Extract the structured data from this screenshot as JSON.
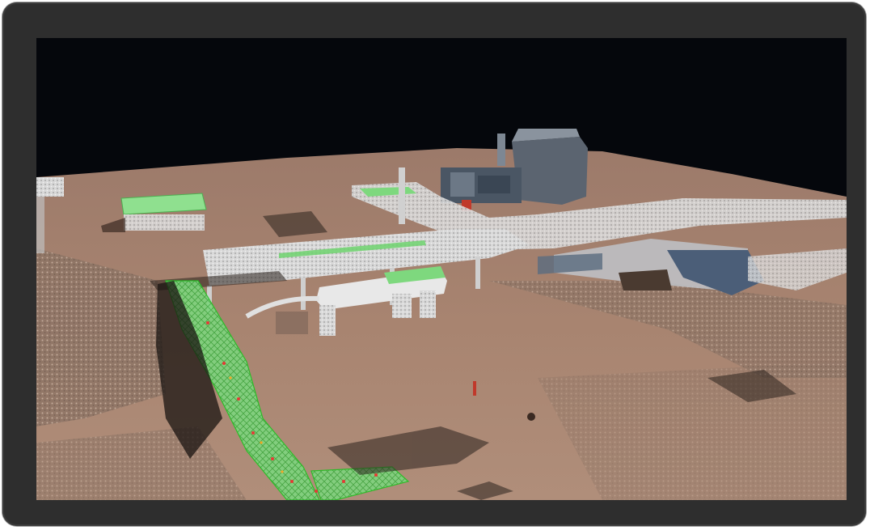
{
  "viewer": {
    "content": "point-cloud-scan",
    "background_color": "#05070c",
    "ground_color": "#a57e6c",
    "highlight_color": "#6bd66b"
  }
}
